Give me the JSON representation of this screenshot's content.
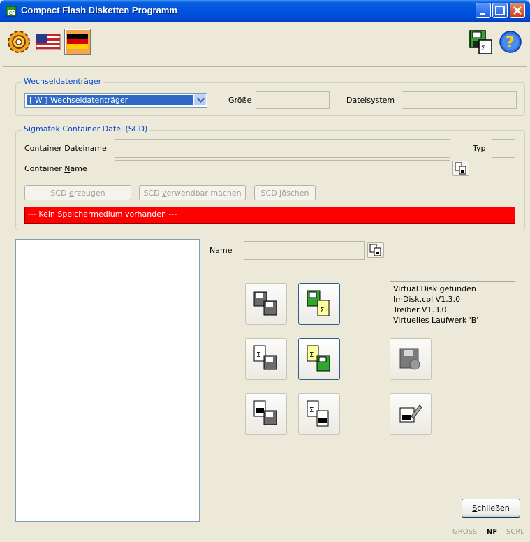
{
  "window": {
    "title": "Compact Flash Disketten Programm"
  },
  "toolbar": {
    "settings_icon": "gear-icon",
    "flag_us_icon": "us-flag-icon",
    "flag_de_icon": "german-flag-icon",
    "disk_icon": "floppy-copy-icon",
    "help_icon": "help-icon"
  },
  "wechsel": {
    "group_title": "Wechseldatenträger",
    "selected_drive": "[ W ]  Wechseldatenträger",
    "size_label": "Größe",
    "size_value": "",
    "fs_label": "Dateisystem",
    "fs_value": ""
  },
  "scd": {
    "group_title": "Sigmatek Container Datei (SCD)",
    "file_label": "Container Dateiname",
    "file_value": "",
    "type_label": "Typ",
    "type_value": "",
    "name_label_pre": "Container ",
    "name_label_u": "N",
    "name_label_post": "ame",
    "name_value": "",
    "btn_create_pre": "SCD ",
    "btn_create_u": "e",
    "btn_create_post": "rzeugen",
    "btn_usable_pre": "SCD ",
    "btn_usable_u": "v",
    "btn_usable_post": "erwendbar machen",
    "btn_delete_pre": "SCD ",
    "btn_delete_u": "l",
    "btn_delete_post": "öschen",
    "error": "--- Kein Speichermedium vorhanden ---"
  },
  "main": {
    "name_label_u": "N",
    "name_label_post": "ame",
    "name_value": "",
    "info_lines": [
      "Virtual Disk gefunden",
      "ImDisk.cpl V1.3.0",
      "Treiber V1.3.0",
      "Virtuelles Laufwerk 'B'"
    ],
    "close_u": "S",
    "close_post": "chließen"
  },
  "statusbar": {
    "gross": "GROSS",
    "nf": "NF",
    "scrl": "SCRL"
  },
  "colors": {
    "error": "#ff0000",
    "accent": "#0054e3",
    "group_title": "#0046d5"
  }
}
